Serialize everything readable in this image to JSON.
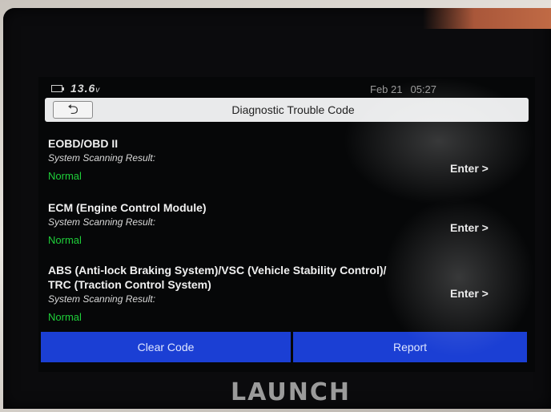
{
  "status_bar": {
    "voltage_value": "13.6",
    "voltage_unit": "v",
    "date": "Feb 21",
    "time": "05:27"
  },
  "header": {
    "back_icon": "back-arrow-icon",
    "title": "Diagnostic Trouble Code"
  },
  "systems": [
    {
      "name": "EOBD/OBD II",
      "scan_label": "System Scanning Result:",
      "status": "Normal",
      "enter_label": "Enter >"
    },
    {
      "name": "ECM (Engine Control Module)",
      "scan_label": "System Scanning Result:",
      "status": "Normal",
      "enter_label": "Enter >"
    },
    {
      "name_line1": "ABS (Anti-lock Braking System)/VSC (Vehicle Stability Control)/",
      "name_line2": "TRC (Traction Control System)",
      "scan_label": "System Scanning Result:",
      "status": "Normal",
      "enter_label": "Enter >"
    }
  ],
  "footer": {
    "clear_code_label": "Clear Code",
    "report_label": "Report"
  },
  "device": {
    "brand": "LAUNCH"
  },
  "colors": {
    "status_normal": "#1fd03a",
    "action_bar": "#1b3fd4",
    "title_bar": "#e9eaeb"
  }
}
